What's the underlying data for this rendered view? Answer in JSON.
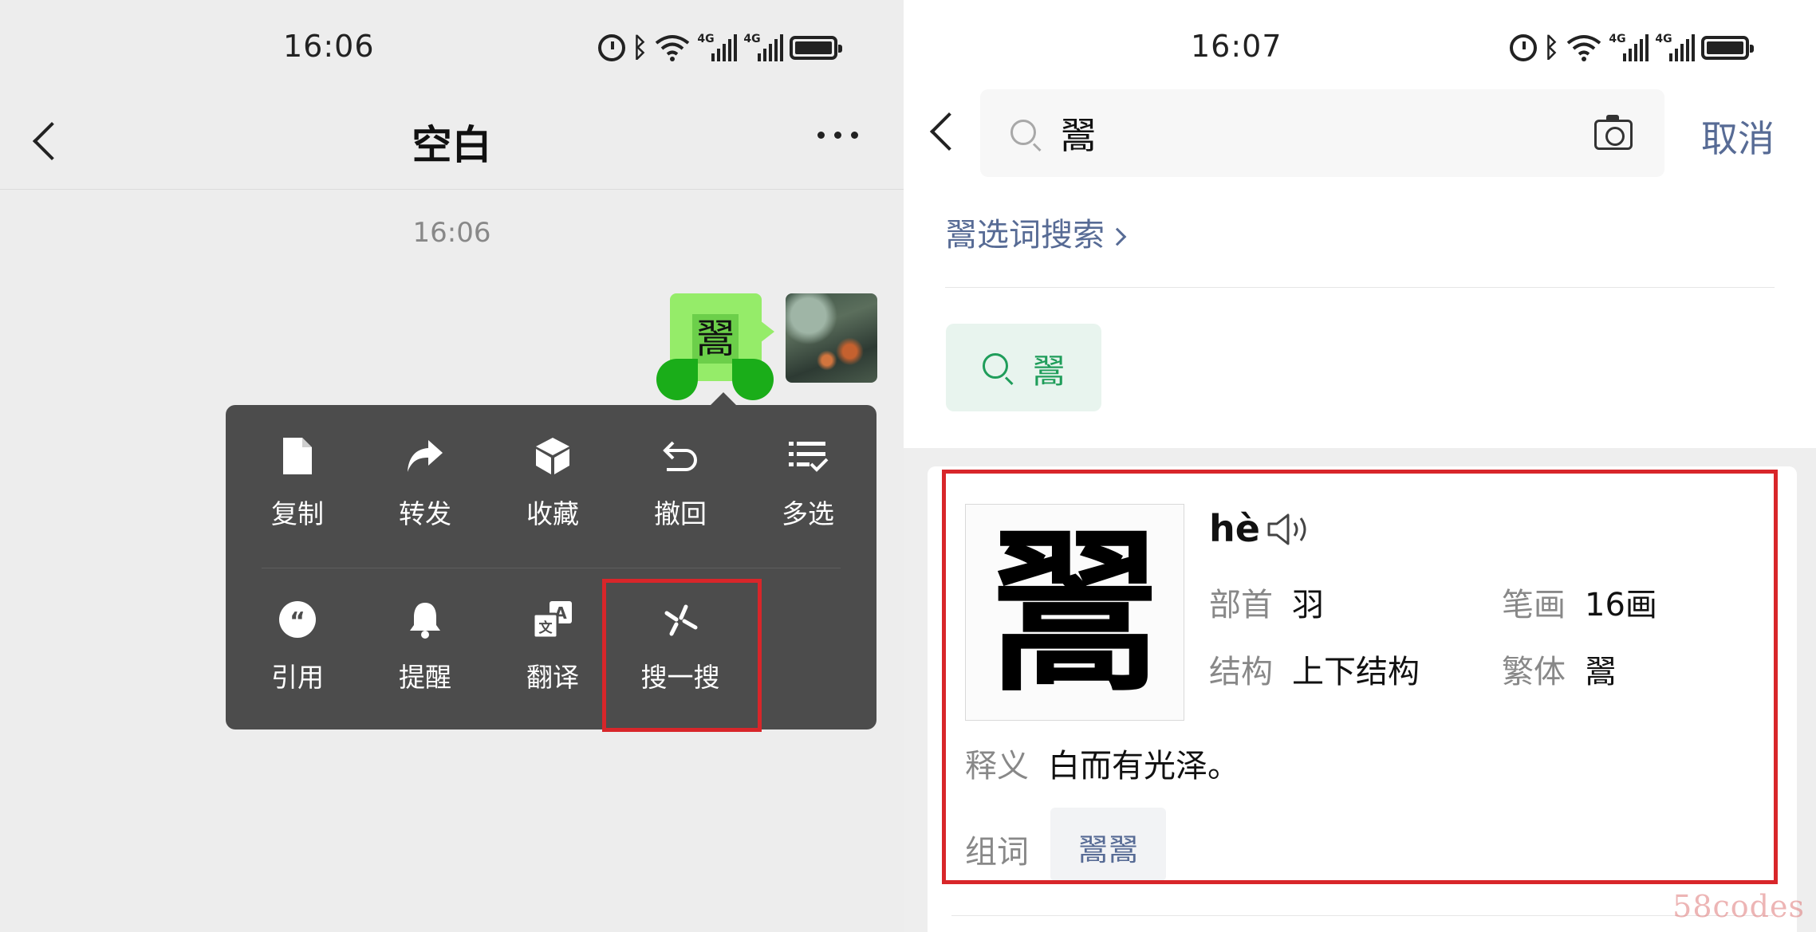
{
  "left": {
    "status": {
      "time": "16:06",
      "signal_labels": [
        "4G",
        "4G"
      ]
    },
    "header": {
      "title": "空白"
    },
    "chat": {
      "timestamp": "16:06",
      "message": "翯"
    },
    "menu": {
      "row1": [
        {
          "label": "复制",
          "icon": "document-icon"
        },
        {
          "label": "转发",
          "icon": "share-arrow-icon"
        },
        {
          "label": "收藏",
          "icon": "cube-icon"
        },
        {
          "label": "撤回",
          "icon": "undo-icon"
        },
        {
          "label": "多选",
          "icon": "multi-select-icon"
        }
      ],
      "row2": [
        {
          "label": "引用",
          "icon": "quote-icon"
        },
        {
          "label": "提醒",
          "icon": "bell-icon"
        },
        {
          "label": "翻译",
          "icon": "translate-icon"
        },
        {
          "label": "搜一搜",
          "icon": "sparkle-search-icon"
        }
      ]
    }
  },
  "right": {
    "status": {
      "time": "16:07",
      "signal_labels": [
        "4G",
        "4G"
      ]
    },
    "search": {
      "value": "翯",
      "cancel_label": "取消"
    },
    "word_search_link": "翯选词搜索",
    "chip": {
      "label": "翯"
    },
    "dict": {
      "character": "翯",
      "pinyin": "hè",
      "radical_key": "部首",
      "radical_value": "羽",
      "strokes_key": "笔画",
      "strokes_value": "16画",
      "structure_key": "结构",
      "structure_value": "上下结构",
      "traditional_key": "繁体",
      "traditional_value": "翯",
      "definition_key": "释义",
      "definition_value": "白而有光泽。",
      "words_key": "组词",
      "words": [
        "翯翯"
      ]
    }
  },
  "watermark": "58codes",
  "colors": {
    "wechat_green_bubble": "#95ec69",
    "handle_green": "#1aad19",
    "menu_bg": "#4c4c4c",
    "highlight_red": "#d8262a",
    "link_blue": "#576b95",
    "chip_green": "#1f9d5a"
  }
}
